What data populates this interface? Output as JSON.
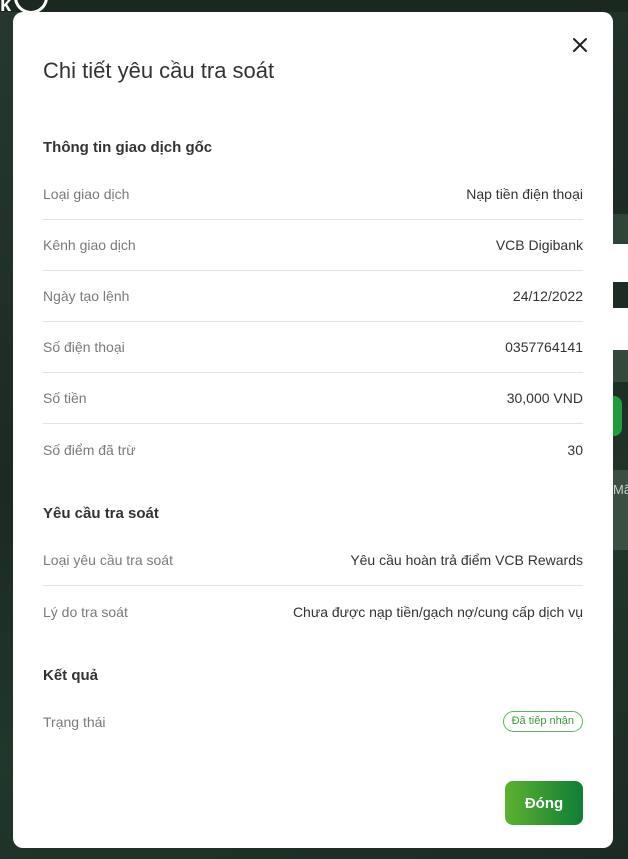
{
  "background": {
    "logo_text": "k",
    "side_snippet": "Mã"
  },
  "modal": {
    "title": "Chi tiết yêu cầu tra soát",
    "close_icon": "close-icon",
    "sections": {
      "original": {
        "title": "Thông tin giao dịch gốc",
        "rows": [
          {
            "label": "Loại giao dịch",
            "value": "Nạp tiền điện thoại"
          },
          {
            "label": "Kênh giao dịch",
            "value": "VCB Digibank"
          },
          {
            "label": "Ngày tạo lệnh",
            "value": "24/12/2022"
          },
          {
            "label": "Số điện thoại",
            "value": "0357764141"
          },
          {
            "label": "Số tiền",
            "value": "30,000 VND"
          },
          {
            "label": "Số điểm đã trừ",
            "value": "30"
          }
        ]
      },
      "request": {
        "title": "Yêu cầu tra soát",
        "rows": [
          {
            "label": "Loại yêu cầu tra soát",
            "value": "Yêu cầu hoàn trả điểm VCB Rewards"
          },
          {
            "label": "Lý do tra soát",
            "value": "Chưa được nạp tiền/gạch nợ/cung cấp dịch vụ"
          }
        ]
      },
      "result": {
        "title": "Kết quả",
        "status_label": "Trạng thái",
        "status_value": "Đã tiếp nhận"
      }
    },
    "close_button_label": "Đóng",
    "colors": {
      "accent_start": "#5db22e",
      "accent_end": "#0f7d37",
      "status_border": "#5cb85c"
    }
  }
}
